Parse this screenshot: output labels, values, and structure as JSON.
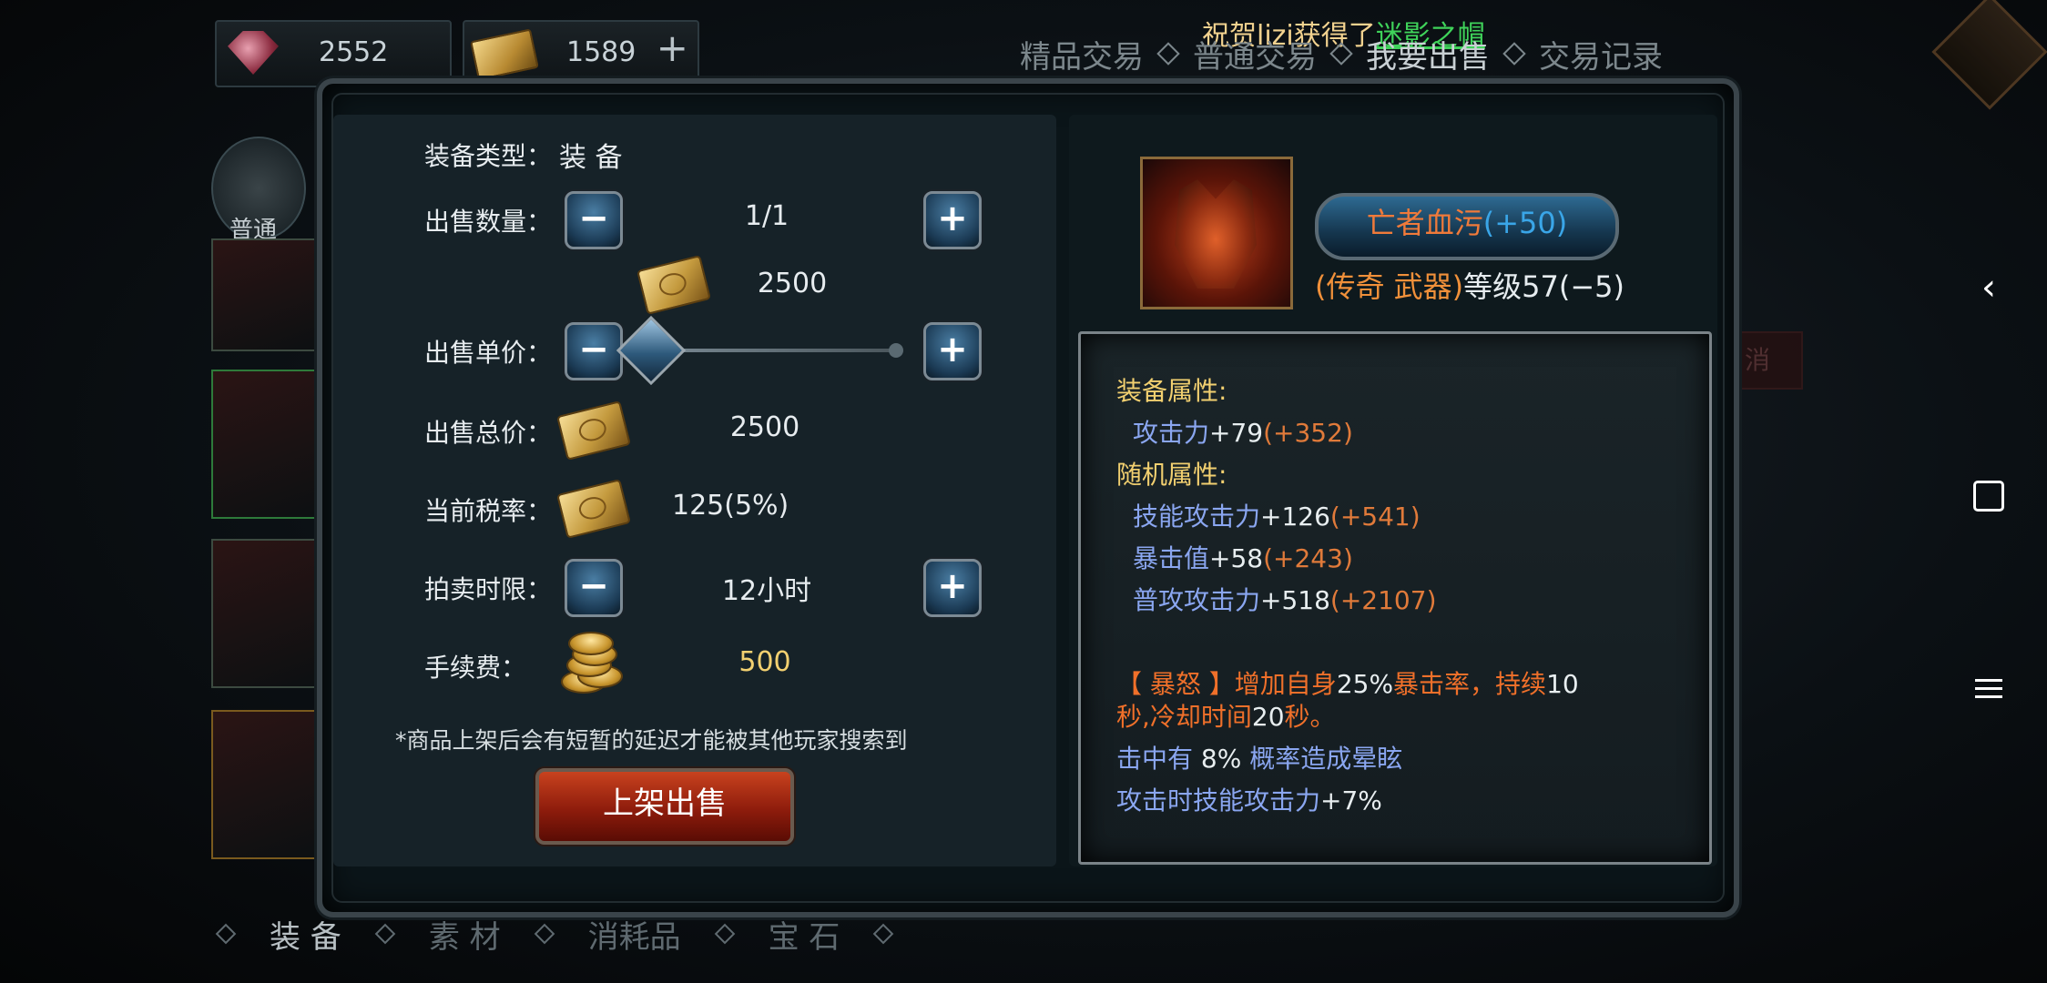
{
  "currency": {
    "gem": "2552",
    "ticket": "1589"
  },
  "news": {
    "prefix": "祝贺lizi获得了",
    "item": "迷影之帽"
  },
  "top_tabs": [
    "精品交易",
    "普通交易",
    "我要出售",
    "交易记录"
  ],
  "left_category": "普通",
  "bottom_tabs": [
    "装 备",
    "素 材",
    "消耗品",
    "宝 石"
  ],
  "ghost": {
    "cancel": "消"
  },
  "form": {
    "type_label": "装备类型：",
    "type_value": "装 备",
    "qty_label": "出售数量：",
    "qty_value": "1/1",
    "price_input": "2500",
    "unit_label": "出售单价：",
    "total_label": "出售总价：",
    "total_value": "2500",
    "tax_label": "当前税率：",
    "tax_value": "125(5%)",
    "time_label": "拍卖时限：",
    "time_value": "12小时",
    "fee_label": "手续费：",
    "fee_value": "500",
    "note": "*商品上架后会有短暂的延迟才能被其他玩家搜索到",
    "sell_button": "上架出售"
  },
  "item": {
    "name": "亡者血污",
    "name_bonus": "(+50)",
    "quality": "(传奇 武器)",
    "level": "等级57(−5)"
  },
  "stats": {
    "equip_header": "装备属性:",
    "attack_label": "攻击力",
    "attack_base": "+79",
    "attack_bonus": "(+352)",
    "random_header": "随机属性:",
    "skill_label": "技能攻击力",
    "skill_base": "+126",
    "skill_bonus": "(+541)",
    "crit_label": "暴击值",
    "crit_base": "+58",
    "crit_bonus": "(+243)",
    "normal_label": "普攻攻击力",
    "normal_base": "+518",
    "normal_bonus": "(+2107)",
    "skill_desc_1a": "【 暴怒 】增加自身",
    "skill_desc_1b": "25%",
    "skill_desc_1c": "暴击率，持续",
    "skill_desc_1d": "10",
    "skill_desc_2a": "秒,冷却时间",
    "skill_desc_2b": "20",
    "skill_desc_2c": "秒。",
    "effect1a": "击中有 ",
    "effect1b": "8%",
    "effect1c": " 概率造成晕眩",
    "effect2a": "攻击时技能攻击力",
    "effect2b": "+7%"
  }
}
